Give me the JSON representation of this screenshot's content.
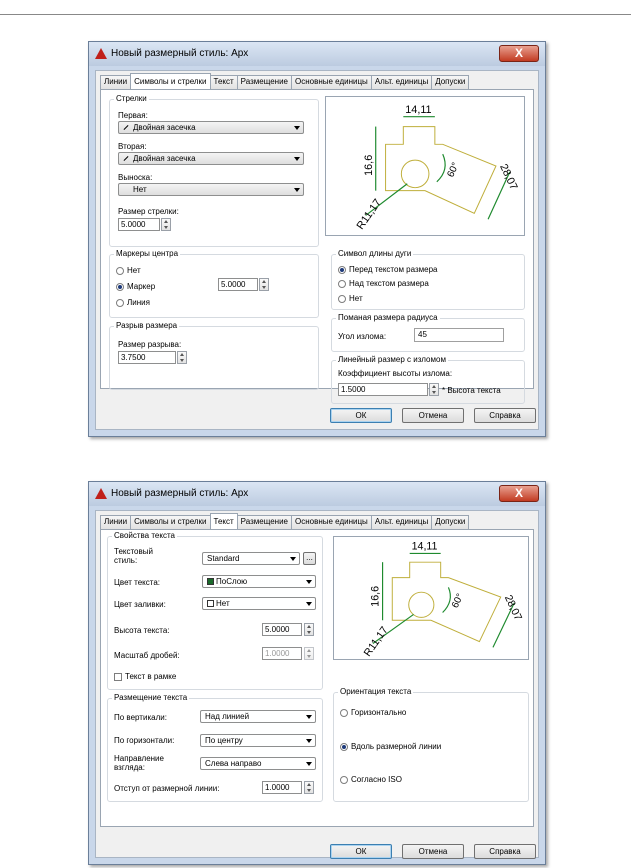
{
  "dialog1": {
    "title": "Новый размерный стиль: Арх",
    "close_label": "X",
    "tabs": [
      "Линии",
      "Символы и стрелки",
      "Текст",
      "Размещение",
      "Основные единицы",
      "Альт. единицы",
      "Допуски"
    ],
    "arrows": {
      "group": "Стрелки",
      "first_label": "Первая:",
      "first_value": "Двойная засечка",
      "second_label": "Вторая:",
      "second_value": "Двойная засечка",
      "leader_label": "Выноска:",
      "leader_value": "Нет",
      "size_label": "Размер стрелки:",
      "size_value": "5.0000"
    },
    "center_marks": {
      "group": "Маркеры центра",
      "options": [
        "Нет",
        "Маркер",
        "Линия"
      ],
      "selected": "Маркер",
      "size_value": "5.0000"
    },
    "dim_break": {
      "group": "Разрыв размера",
      "label": "Размер разрыва:",
      "value": "3.7500"
    },
    "arc_symbol": {
      "group": "Символ длины дуги",
      "options": [
        "Перед текстом размера",
        "Над текстом размера",
        "Нет"
      ],
      "selected": "Перед текстом размера"
    },
    "radius_jog": {
      "group": "Поманая размера радиуса",
      "label": "Угол излома:",
      "value": "45"
    },
    "linear_jog": {
      "group": "Линейный размер с изломом",
      "label": "Коэффициент высоты излома:",
      "value": "1.5000",
      "suffix": "* Высота текста"
    },
    "buttons": {
      "ok": "ОК",
      "cancel": "Отмена",
      "help": "Справка"
    }
  },
  "dialog2": {
    "title": "Новый размерный стиль: Арх",
    "close_label": "X",
    "tabs": [
      "Линии",
      "Символы и стрелки",
      "Текст",
      "Размещение",
      "Основные единицы",
      "Альт. единицы",
      "Допуски"
    ],
    "text_props": {
      "group": "Свойства текста",
      "style_label_1": "Текстовый",
      "style_label_2": "стиль:",
      "style_value": "Standard",
      "style_btn": "...",
      "color_label": "Цвет текста:",
      "color_value": "ПоСлою",
      "fill_label": "Цвет заливки:",
      "fill_value": "Нет",
      "height_label": "Высота текста:",
      "height_value": "5.0000",
      "fraction_label": "Масштаб дробей:",
      "fraction_value": "1.0000",
      "frame_label": "Текст в рамке"
    },
    "placement": {
      "group": "Размещение текста",
      "vertical_label": "По вертикали:",
      "vertical_value": "Над линией",
      "horizontal_label": "По горизонтали:",
      "horizontal_value": "По центру",
      "direction_label_1": "Направление",
      "direction_label_2": "взгляда:",
      "direction_value": "Слева направо",
      "offset_label": "Отступ от размерной линии:",
      "offset_value": "1.0000"
    },
    "orientation": {
      "group": "Ориентация текста",
      "options": [
        "Горизонтально",
        "Вдоль размерной линии",
        "Согласно ISO"
      ],
      "selected": "Вдоль размерной линии"
    },
    "buttons": {
      "ok": "ОК",
      "cancel": "Отмена",
      "help": "Справка"
    }
  },
  "preview": {
    "dim_top": "14,11",
    "dim_left": "16,6",
    "dim_right": "28,07",
    "dim_angle": "60°",
    "dim_radius": "R11,17"
  },
  "colors": {
    "dim_line": "#1e8a2e",
    "geometry": "#bfae3a",
    "color_swatch": "#1a6a2a"
  }
}
